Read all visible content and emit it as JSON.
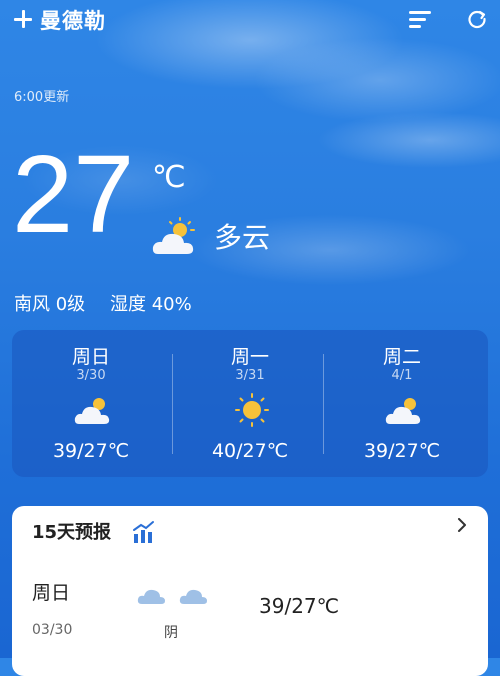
{
  "header": {
    "city": "曼德勒"
  },
  "current": {
    "update_time": "6:00更新",
    "temperature": "27",
    "unit": "℃",
    "condition": "多云",
    "wind": "南风 0级",
    "humidity": "湿度 40%"
  },
  "forecast": [
    {
      "day": "周日",
      "date": "3/30",
      "icon": "partly-cloudy-icon",
      "range": "39/27℃"
    },
    {
      "day": "周一",
      "date": "3/31",
      "icon": "sunny-icon",
      "range": "40/27℃"
    },
    {
      "day": "周二",
      "date": "4/1",
      "icon": "partly-cloudy-icon",
      "range": "39/27℃"
    }
  ],
  "long_forecast": {
    "title": "15天预报",
    "row": {
      "day": "周日",
      "date": "03/30",
      "condition": "阴",
      "range": "39/27℃",
      "icons": [
        "cloudy-icon",
        "cloudy-icon"
      ]
    }
  },
  "colors": {
    "sky_top": "#2f86e6",
    "sky_bottom": "#1a66d2",
    "sun": "#f6c23a",
    "chart_icon": "#2a6fd6"
  }
}
